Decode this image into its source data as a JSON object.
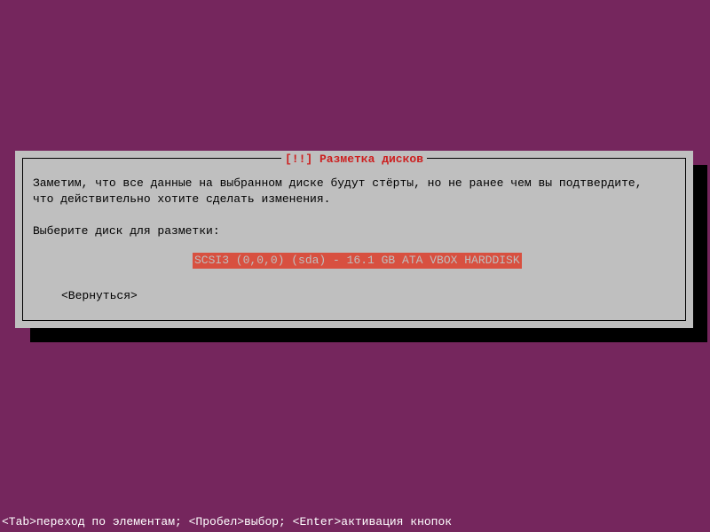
{
  "colors": {
    "background": "#75265d",
    "dialog_bg": "#bfbfbf",
    "title_fg": "#cc2020",
    "highlight_bg": "#d85040",
    "highlight_fg": "#bfbfbf",
    "shadow": "#000000",
    "footer_fg": "#ffffff"
  },
  "dialog": {
    "title": "[!!] Разметка дисков",
    "body": "Заметим, что все данные на выбранном диске будут стёрты, но не ранее чем вы подтвердите,\nчто действительно хотите сделать изменения.",
    "prompt": "Выберите диск для разметки:",
    "disks": [
      "SCSI3 (0,0,0) (sda) - 16.1 GB ATA VBOX HARDDISK"
    ],
    "back_label": "<Вернуться>"
  },
  "footer": {
    "text": "<Tab>переход по элементам; <Пробел>выбор; <Enter>активация кнопок"
  }
}
